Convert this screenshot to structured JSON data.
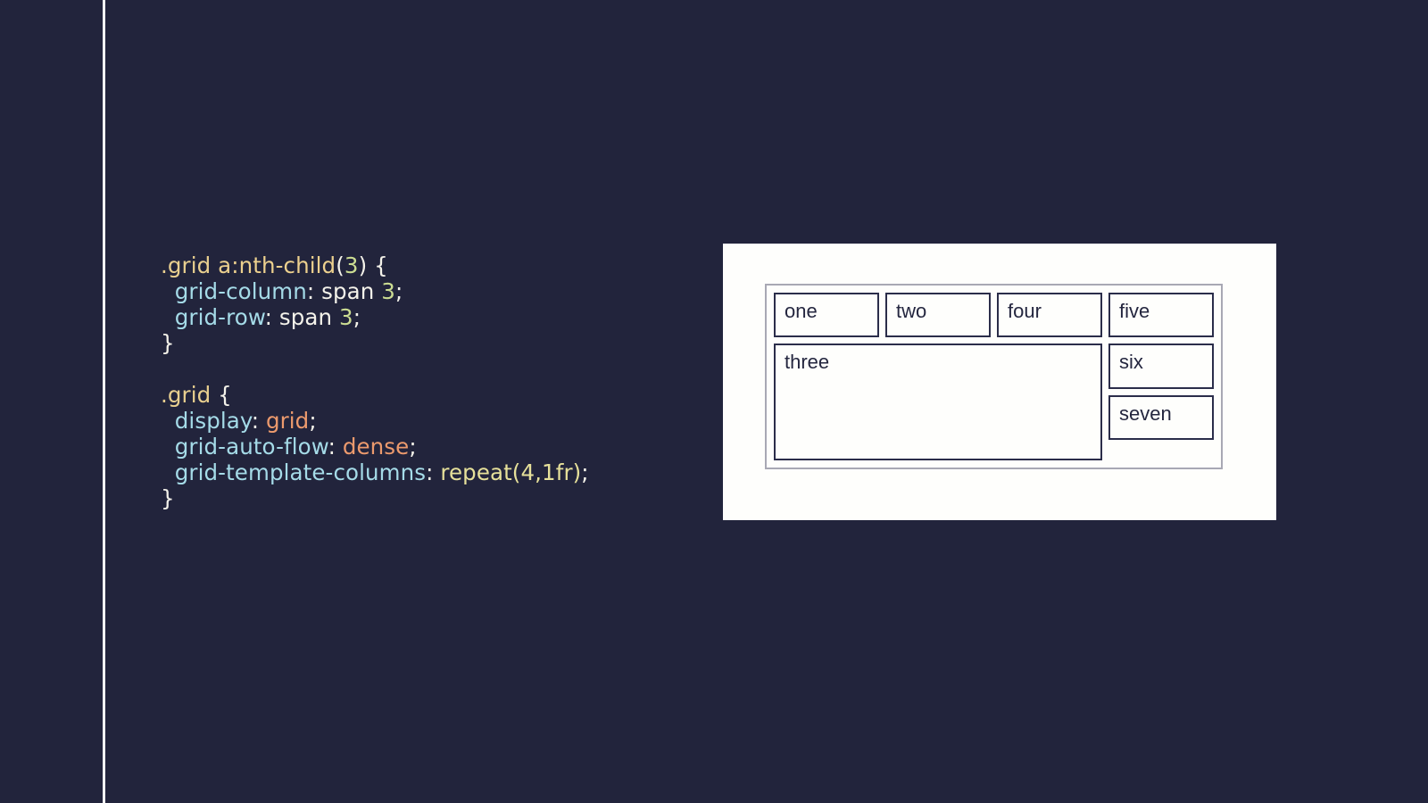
{
  "slide": {
    "background_color": "#22243c",
    "accent_rule_color": "#f2f2f6"
  },
  "code": {
    "language": "css",
    "lines": [
      {
        "id": "line-1",
        "tokens": [
          {
            "text": ".grid ",
            "kind": "sel"
          },
          {
            "text": "a:nth-child",
            "kind": "pseudo"
          },
          {
            "text": "(",
            "kind": "plain"
          },
          {
            "text": "3",
            "kind": "num"
          },
          {
            "text": ") {",
            "kind": "plain"
          }
        ]
      },
      {
        "id": "line-2",
        "tokens": [
          {
            "text": "  ",
            "kind": "plain"
          },
          {
            "text": "grid-column",
            "kind": "prop"
          },
          {
            "text": ": span ",
            "kind": "plain"
          },
          {
            "text": "3",
            "kind": "num"
          },
          {
            "text": ";",
            "kind": "plain"
          }
        ]
      },
      {
        "id": "line-3",
        "tokens": [
          {
            "text": "  ",
            "kind": "plain"
          },
          {
            "text": "grid-row",
            "kind": "prop"
          },
          {
            "text": ": span ",
            "kind": "plain"
          },
          {
            "text": "3",
            "kind": "num"
          },
          {
            "text": ";",
            "kind": "plain"
          }
        ]
      },
      {
        "id": "line-4",
        "tokens": [
          {
            "text": "}",
            "kind": "plain"
          }
        ]
      },
      {
        "id": "line-5",
        "tokens": []
      },
      {
        "id": "line-6",
        "tokens": [
          {
            "text": ".grid",
            "kind": "sel"
          },
          {
            "text": " {",
            "kind": "plain"
          }
        ]
      },
      {
        "id": "line-7",
        "tokens": [
          {
            "text": "  ",
            "kind": "plain"
          },
          {
            "text": "display",
            "kind": "prop"
          },
          {
            "text": ": ",
            "kind": "plain"
          },
          {
            "text": "grid",
            "kind": "kw"
          },
          {
            "text": ";",
            "kind": "plain"
          }
        ]
      },
      {
        "id": "line-8",
        "tokens": [
          {
            "text": "  ",
            "kind": "plain"
          },
          {
            "text": "grid-auto-flow",
            "kind": "prop"
          },
          {
            "text": ": ",
            "kind": "plain"
          },
          {
            "text": "dense",
            "kind": "kw"
          },
          {
            "text": ";",
            "kind": "plain"
          }
        ]
      },
      {
        "id": "line-9",
        "tokens": [
          {
            "text": "  ",
            "kind": "plain"
          },
          {
            "text": "grid-template-columns",
            "kind": "prop"
          },
          {
            "text": ": ",
            "kind": "plain"
          },
          {
            "text": "repeat(4,1fr)",
            "kind": "func"
          },
          {
            "text": ";",
            "kind": "plain"
          }
        ]
      },
      {
        "id": "line-10",
        "tokens": [
          {
            "text": "}",
            "kind": "plain"
          }
        ]
      }
    ],
    "token_colors": {
      "sel": "#e8cf8f",
      "pseudo": "#ecd08e",
      "prop": "#a5dbe8",
      "plain": "#f4f2ea",
      "num": "#cbdc92",
      "kw": "#ec9a6d",
      "func": "#e6e09a"
    }
  },
  "demo": {
    "panel_background": "#fefefc",
    "frame_border_color": "#a8a8b4",
    "cell_border_color": "#2b2d4a",
    "cell_text_color": "#24263f",
    "columns": 4,
    "auto_flow": "dense",
    "cells": [
      {
        "label": "one",
        "span": false
      },
      {
        "label": "two",
        "span": false
      },
      {
        "label": "three",
        "span": true
      },
      {
        "label": "four",
        "span": false
      },
      {
        "label": "five",
        "span": false
      },
      {
        "label": "six",
        "span": false
      },
      {
        "label": "seven",
        "span": false
      }
    ]
  }
}
